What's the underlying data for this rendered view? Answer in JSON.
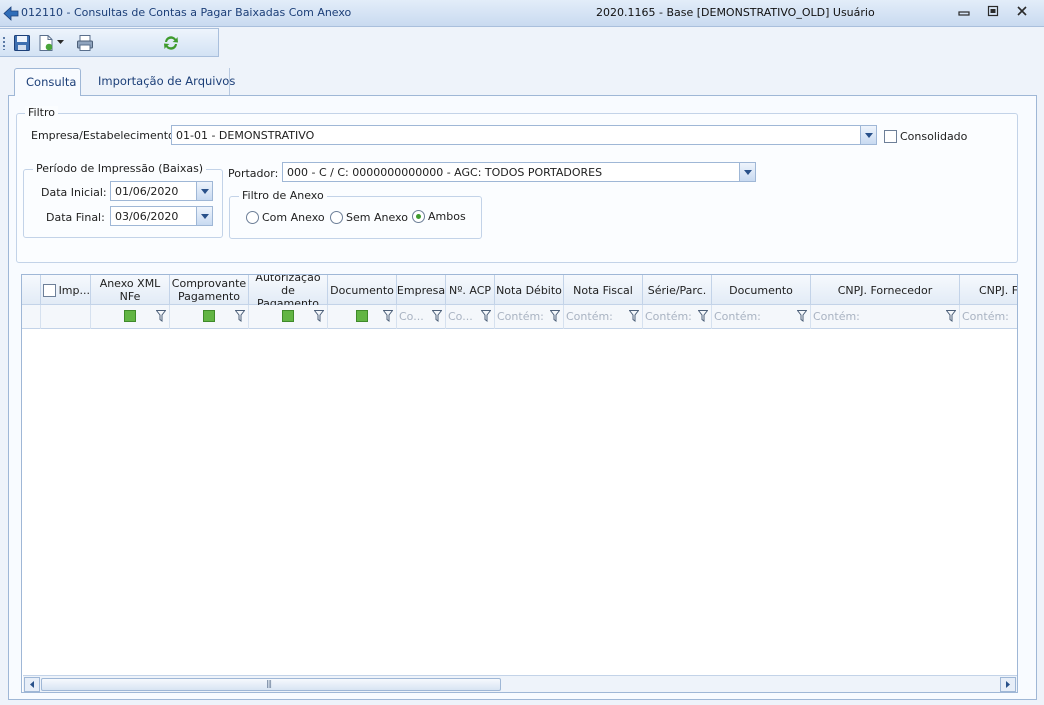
{
  "window": {
    "title": "012110 - Consultas de Contas a Pagar Baixadas Com Anexo",
    "base_info": "2020.1165 - Base [DEMONSTRATIVO_OLD] Usuário",
    "minimize": "▭",
    "restore": "◻",
    "close": "✕"
  },
  "toolbar": {
    "icons": [
      "save-icon",
      "new-document-icon",
      "print-icon",
      "refresh-icon"
    ]
  },
  "tabs": [
    {
      "label": "Consulta",
      "active": true
    },
    {
      "label": "Importação de Arquivos",
      "active": false
    }
  ],
  "filter": {
    "legend": "Filtro",
    "empresa_label": "Empresa/Estabelecimento:",
    "empresa_value": "01-01 - DEMONSTRATIVO",
    "consolidado_label": "Consolidado",
    "periodo_legend": "Período de Impressão (Baixas)",
    "data_inicial_label": "Data Inicial:",
    "data_inicial_value": "01/06/2020",
    "data_final_label": "Data Final:",
    "data_final_value": "03/06/2020",
    "portador_label": "Portador:",
    "portador_value": "000 - C / C: 0000000000000 - AGC: TODOS PORTADORES",
    "anexo_legend": "Filtro de Anexo",
    "anexo_options": [
      {
        "label": "Com Anexo",
        "selected": false
      },
      {
        "label": "Sem Anexo",
        "selected": false
      },
      {
        "label": "Ambos",
        "selected": true
      }
    ]
  },
  "grid": {
    "columns": [
      {
        "label": ""
      },
      {
        "label": "Imp..."
      },
      {
        "label": "Anexo XML\nNFe"
      },
      {
        "label": "Comprovante\nPagamento"
      },
      {
        "label": "Autorização de\nPagamento"
      },
      {
        "label": "Documento"
      },
      {
        "label": "Empresa"
      },
      {
        "label": "Nº. ACP"
      },
      {
        "label": "Nota Débito"
      },
      {
        "label": "Nota Fiscal"
      },
      {
        "label": "Série/Parc."
      },
      {
        "label": "Documento"
      },
      {
        "label": "CNPJ. Fornecedor"
      },
      {
        "label": "CNPJ. Fo"
      }
    ],
    "filter_row": [
      "",
      "",
      "",
      "",
      "",
      "",
      "Co...",
      "Co...",
      "Contém:",
      "Contém:",
      "Contém:",
      "Contém:",
      "Contém:",
      "Contém:"
    ],
    "scroll_grip": "|||"
  }
}
